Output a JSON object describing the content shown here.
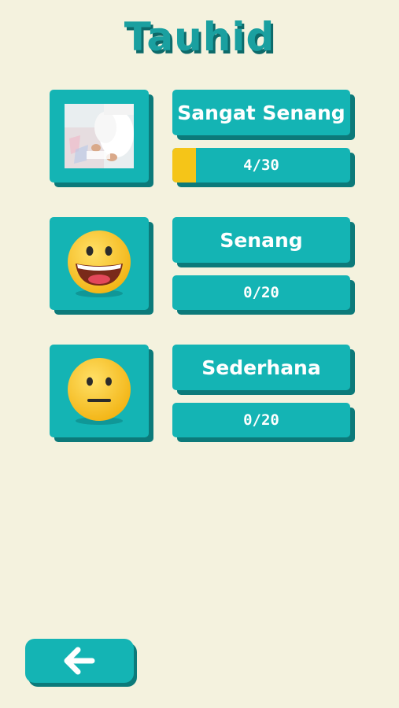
{
  "header": {
    "title": "Tauhid"
  },
  "levels": [
    {
      "label": "Sangat Senang",
      "progress_text": "4/30",
      "progress_fraction": 0.133,
      "icon": "photo-thumbnail"
    },
    {
      "label": "Senang",
      "progress_text": "0/20",
      "progress_fraction": 0,
      "icon": "big-smile-emoji-icon"
    },
    {
      "label": "Sederhana",
      "progress_text": "0/20",
      "progress_fraction": 0,
      "icon": "neutral-face-emoji-icon"
    }
  ],
  "footer": {
    "back_icon": "arrow-left-icon"
  },
  "colors": {
    "background": "#f4f2de",
    "card": "#14b4b4",
    "card_shadow": "#0c7a7a",
    "title": "#1aa0a0",
    "progress_fill": "#f5c518",
    "emoji_face": "#f7c31c"
  }
}
